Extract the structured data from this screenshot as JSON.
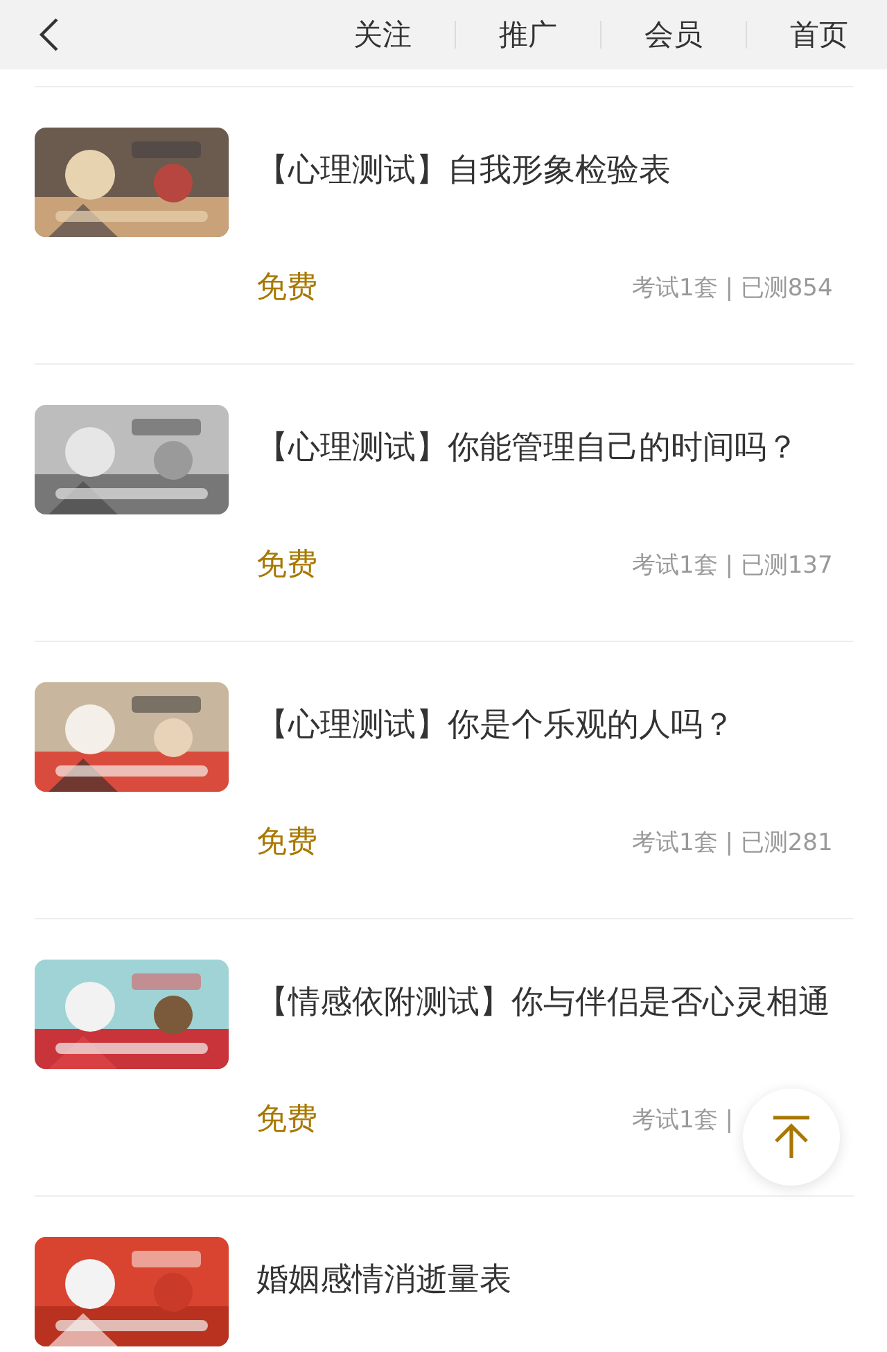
{
  "header": {
    "tabs": [
      {
        "label": "关注"
      },
      {
        "label": "推广"
      },
      {
        "label": "会员"
      },
      {
        "label": "首页"
      }
    ]
  },
  "items": [
    {
      "title": "【心理测试】自我形象检验表",
      "price": "免费",
      "stats": "考试1套 | 已测854"
    },
    {
      "title": "【心理测试】你能管理自己的时间吗？",
      "price": "免费",
      "stats": "考试1套 | 已测137"
    },
    {
      "title": "【心理测试】你是个乐观的人吗？",
      "price": "免费",
      "stats": "考试1套 | 已测281"
    },
    {
      "title": "【情感依附测试】你与伴侣是否心灵相通",
      "price": "免费",
      "stats": "考试1套 |"
    },
    {
      "title": "婚姻感情消逝量表"
    }
  ]
}
